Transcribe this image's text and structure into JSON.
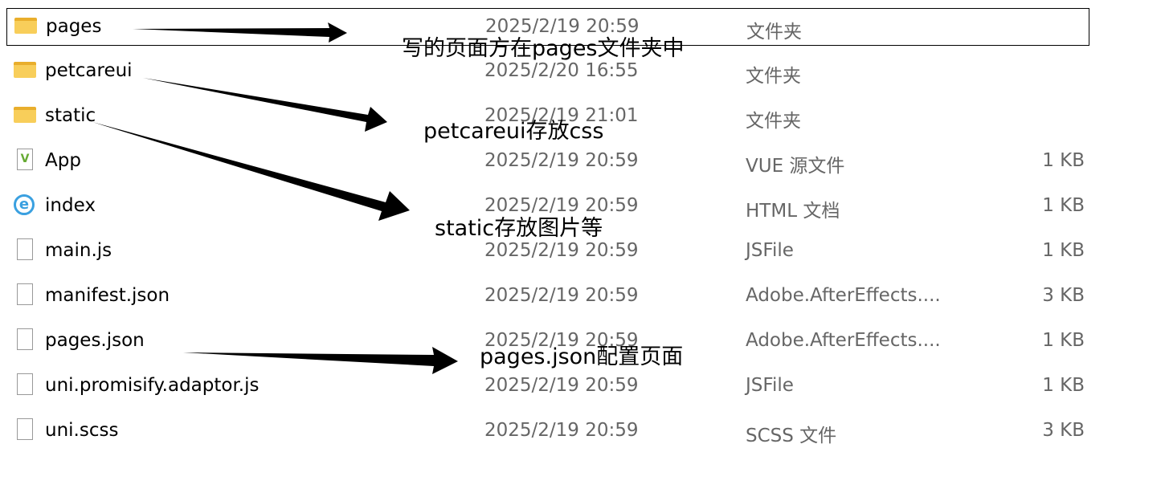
{
  "files": [
    {
      "name": "pages",
      "date": "2025/2/19 20:59",
      "type": "文件夹",
      "size": "",
      "icon": "folder-icon",
      "selected": true
    },
    {
      "name": "petcareui",
      "date": "2025/2/20 16:55",
      "type": "文件夹",
      "size": "",
      "icon": "folder-icon"
    },
    {
      "name": "static",
      "date": "2025/2/19 21:01",
      "type": "文件夹",
      "size": "",
      "icon": "folder-icon"
    },
    {
      "name": "App",
      "date": "2025/2/19 20:59",
      "type": "VUE 源文件",
      "size": "1 KB",
      "icon": "vue-file-icon"
    },
    {
      "name": "index",
      "date": "2025/2/19 20:59",
      "type": "HTML 文档",
      "size": "1 KB",
      "icon": "ie-html-icon"
    },
    {
      "name": "main.js",
      "date": "2025/2/19 20:59",
      "type": "JSFile",
      "size": "1 KB",
      "icon": "file-icon"
    },
    {
      "name": "manifest.json",
      "date": "2025/2/19 20:59",
      "type": "Adobe.AfterEffects....",
      "size": "3 KB",
      "icon": "file-icon"
    },
    {
      "name": "pages.json",
      "date": "2025/2/19 20:59",
      "type": "Adobe.AfterEffects....",
      "size": "1 KB",
      "icon": "file-icon"
    },
    {
      "name": "uni.promisify.adaptor.js",
      "date": "2025/2/19 20:59",
      "type": "JSFile",
      "size": "1 KB",
      "icon": "file-icon"
    },
    {
      "name": "uni.scss",
      "date": "2025/2/19 20:59",
      "type": "SCSS 文件",
      "size": "3 KB",
      "icon": "file-icon"
    }
  ],
  "annotations": {
    "pages": "写的页面方在pages文件夹中",
    "petcareui": "petcareui存放css",
    "static": "static存放图片等",
    "pages_json": "pages.json配置页面"
  }
}
